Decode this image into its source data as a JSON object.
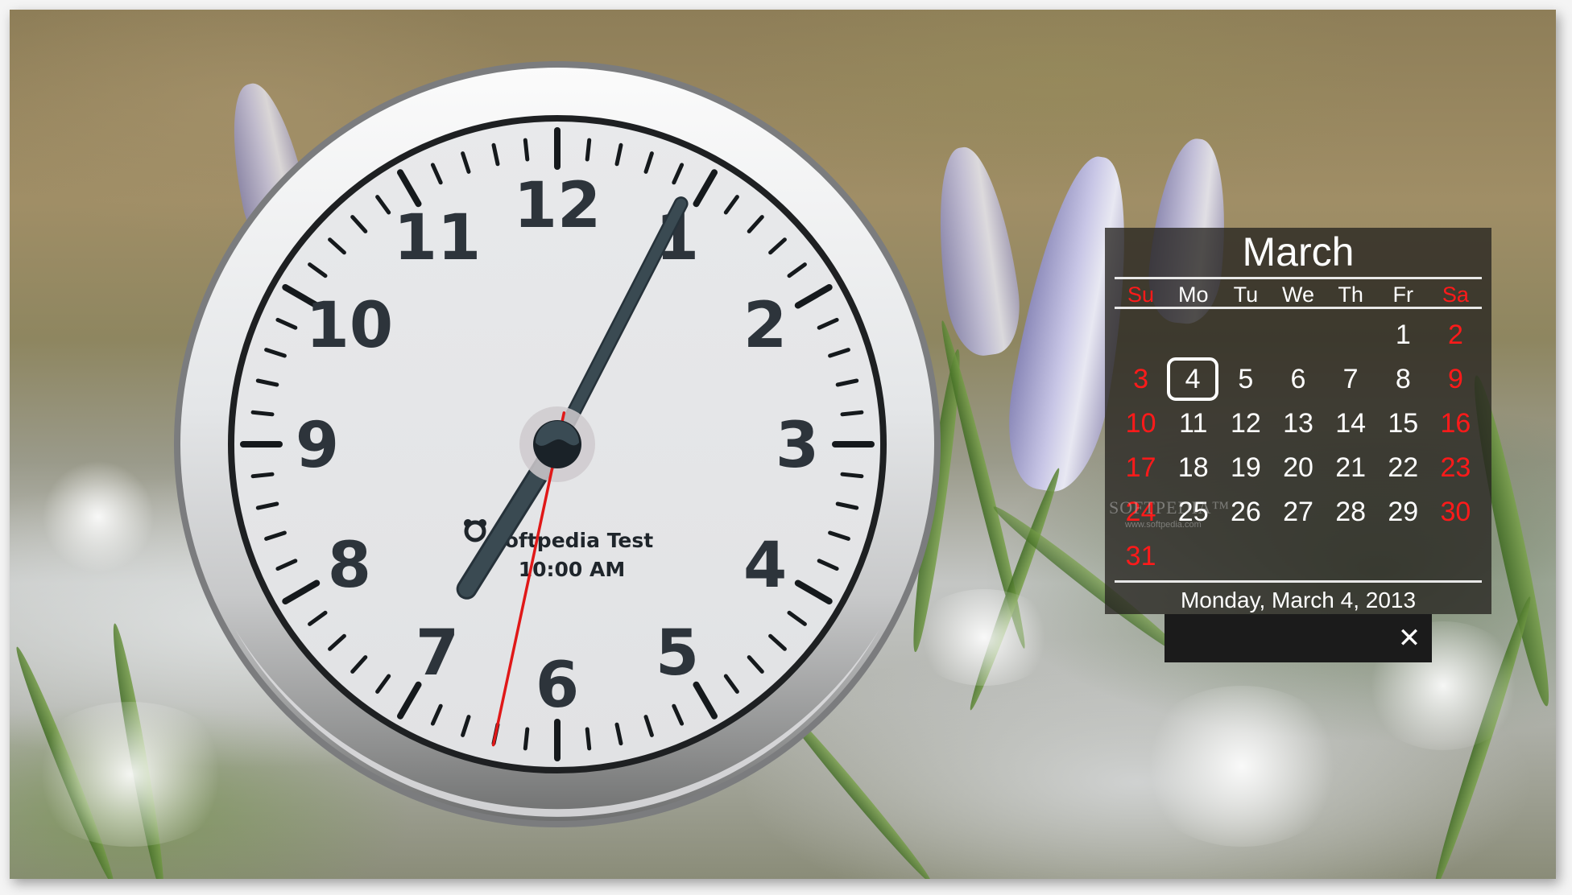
{
  "clock": {
    "numerals": [
      "12",
      "1",
      "2",
      "3",
      "4",
      "5",
      "6",
      "7",
      "8",
      "9",
      "10",
      "11"
    ],
    "time": {
      "hours": 7,
      "minutes": 4,
      "seconds": 32
    },
    "alarm": {
      "icon": "alarm-clock-icon",
      "label": "Softpedia Test",
      "time": "10:00 AM"
    },
    "colors": {
      "numerals": "#2d343b",
      "hands": "#36454d",
      "second_hand": "#e01818",
      "face": "#f8f9fa",
      "face_lower": "#e4e5e7"
    }
  },
  "calendar": {
    "month": "March",
    "weekdays": [
      "Su",
      "Mo",
      "Tu",
      "We",
      "Th",
      "Fr",
      "Sa"
    ],
    "weeks": [
      [
        "",
        "",
        "",
        "",
        "",
        "1",
        "2"
      ],
      [
        "3",
        "4",
        "5",
        "6",
        "7",
        "8",
        "9"
      ],
      [
        "10",
        "11",
        "12",
        "13",
        "14",
        "15",
        "16"
      ],
      [
        "17",
        "18",
        "19",
        "20",
        "21",
        "22",
        "23"
      ],
      [
        "24",
        "25",
        "26",
        "27",
        "28",
        "29",
        "30"
      ],
      [
        "31",
        "",
        "",
        "",
        "",
        "",
        ""
      ]
    ],
    "today": "4",
    "footer_date": "Monday, March 4, 2013",
    "colors": {
      "weekend": "#ff1a1a",
      "weekday": "#ffffff"
    }
  },
  "close_bar": {
    "close_icon": "close-icon",
    "close_glyph": "✕"
  },
  "watermark": {
    "brand": "SOFTPEDIA™",
    "url": "www.softpedia.com"
  }
}
